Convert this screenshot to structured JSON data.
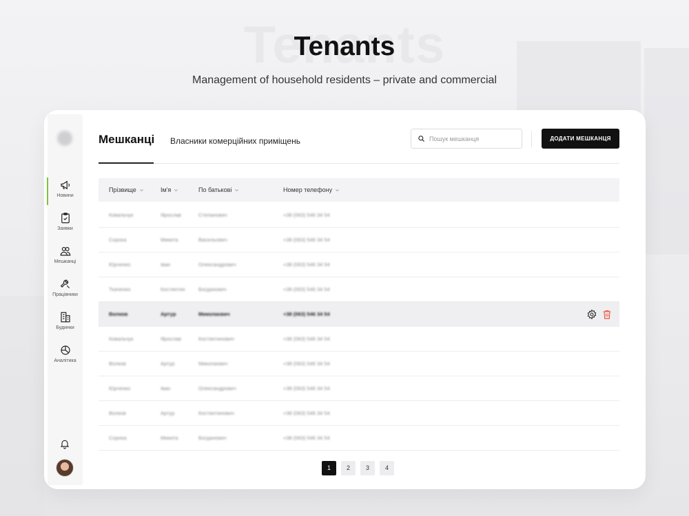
{
  "hero": {
    "ghost_text": "Tenants",
    "title": "Tenants",
    "subtitle": "Management of household residents – private and commercial"
  },
  "sidebar": {
    "items": [
      {
        "label": "Новини",
        "icon": "megaphone-icon",
        "active": true
      },
      {
        "label": "Заявки",
        "icon": "clipboard-icon",
        "active": false
      },
      {
        "label": "Мешканці",
        "icon": "users-icon",
        "active": false
      },
      {
        "label": "Працівники",
        "icon": "wrench-icon",
        "active": false
      },
      {
        "label": "Будинки",
        "icon": "buildings-icon",
        "active": false
      },
      {
        "label": "Аналітика",
        "icon": "pie-chart-icon",
        "active": false
      }
    ],
    "accent_color": "#7dc242"
  },
  "tabs": [
    {
      "label": "Мешканці",
      "active": true
    },
    {
      "label": "Власники комерційних приміщень",
      "active": false
    }
  ],
  "search": {
    "placeholder": "Пошук мешканця",
    "value": ""
  },
  "add_button": {
    "label": "ДОДАТИ МЕШКАНЦЯ"
  },
  "table": {
    "columns": [
      "Прізвище",
      "Ім'я",
      "По батькові",
      "Номер телефону"
    ],
    "rows": [
      {
        "surname": "Ковальчук",
        "name": "Ярослав",
        "patronymic": "Степанович",
        "phone": "+38 (063) 546 34 54"
      },
      {
        "surname": "Сорока",
        "name": "Микита",
        "patronymic": "Васильович",
        "phone": "+38 (063) 546 34 54"
      },
      {
        "surname": "Юрченко",
        "name": "Іван",
        "patronymic": "Олександрович",
        "phone": "+38 (063) 546 34 54"
      },
      {
        "surname": "Ткаченко",
        "name": "Костянтин",
        "patronymic": "Богданович",
        "phone": "+38 (063) 546 34 54"
      },
      {
        "surname": "Волков",
        "name": "Артур",
        "patronymic": "Миколаєвич",
        "phone": "+38 (063) 546 34 54"
      },
      {
        "surname": "Ковальчук",
        "name": "Ярослав",
        "patronymic": "Костянтинович",
        "phone": "+38 (063) 546 34 54"
      },
      {
        "surname": "Волков",
        "name": "Артур",
        "patronymic": "Миколаєвич",
        "phone": "+38 (063) 546 34 54"
      },
      {
        "surname": "Юрченко",
        "name": "Іван",
        "patronymic": "Олександрович",
        "phone": "+38 (063) 546 34 54"
      },
      {
        "surname": "Волков",
        "name": "Артур",
        "patronymic": "Костянтинович",
        "phone": "+38 (063) 546 34 54"
      },
      {
        "surname": "Сорока",
        "name": "Микита",
        "patronymic": "Богданович",
        "phone": "+38 (063) 546 34 54"
      }
    ],
    "highlighted_row": 4,
    "delete_color": "#e8553e"
  },
  "pagination": {
    "pages": [
      "1",
      "2",
      "3",
      "4"
    ],
    "current": "1"
  }
}
